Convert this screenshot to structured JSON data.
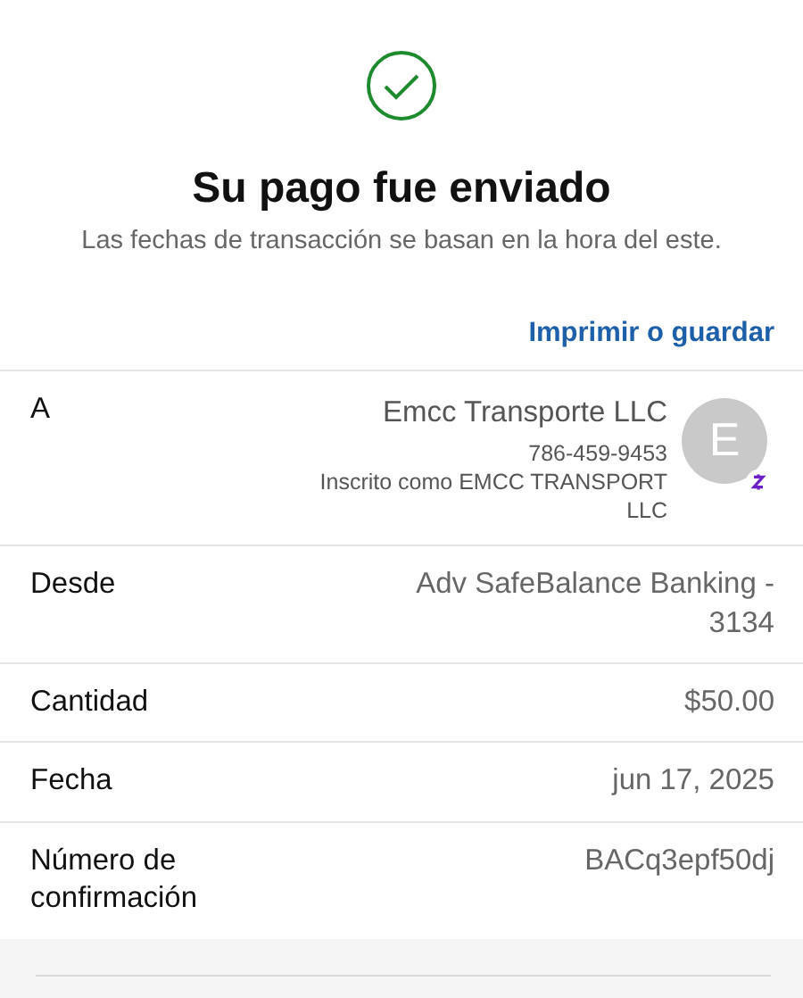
{
  "header": {
    "title": "Su pago fue enviado",
    "subtitle": "Las fechas de transacción se basan en la hora del este.",
    "print_link": "Imprimir o guardar"
  },
  "details": [
    {
      "kind": "recipient",
      "label": "A",
      "name": "Emcc Transporte LLC",
      "phone": "786-459-9453",
      "enrolled": "Inscrito como EMCC TRANSPORT LLC",
      "avatar": "E"
    },
    {
      "kind": "plain",
      "label": "Desde",
      "value": "Adv SafeBalance Banking - 3134"
    },
    {
      "kind": "plain",
      "label": "Cantidad",
      "value": "$50.00"
    },
    {
      "kind": "plain",
      "label": "Fecha",
      "value": "jun 17, 2025"
    },
    {
      "kind": "plain",
      "label": "Número de confirmación",
      "value": "BACq3epf50dj"
    }
  ]
}
